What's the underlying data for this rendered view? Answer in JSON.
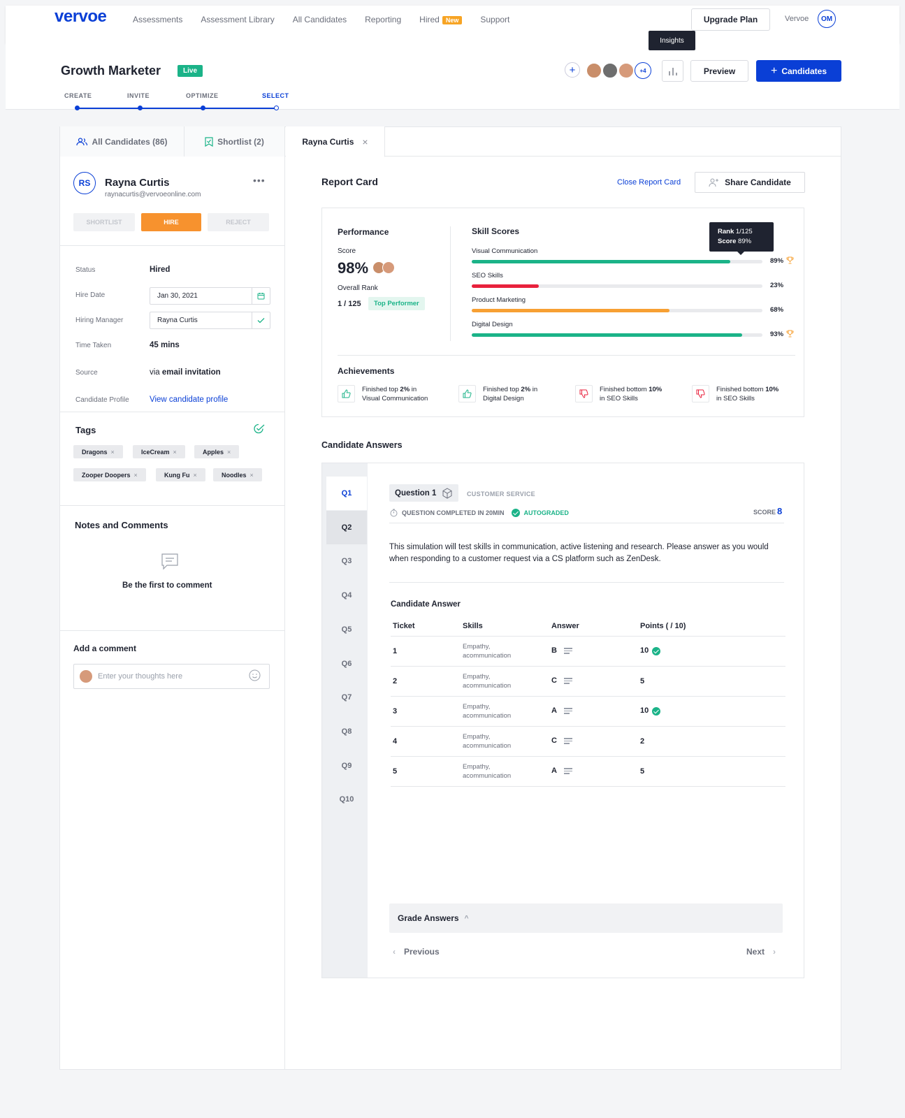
{
  "nav": {
    "logo": "vervoe",
    "links": [
      "Assessments",
      "Assessment Library",
      "All Candidates",
      "Reporting",
      "Hired",
      "Support"
    ],
    "new_badge": "New",
    "upgrade": "Upgrade Plan",
    "account": "Vervoe",
    "avatar": "OM"
  },
  "header": {
    "title": "Growth Marketer",
    "status": "Live",
    "steps": [
      "CREATE",
      "INVITE",
      "OPTIMIZE",
      "SELECT"
    ],
    "more_avatars": "+4",
    "insights_tooltip": "Insights",
    "preview": "Preview",
    "candidates": "Candidates"
  },
  "tabs": {
    "all": "All Candidates (86)",
    "shortlist": "Shortlist (2)",
    "current": "Rayna Curtis"
  },
  "candidate": {
    "initials": "RS",
    "name": "Rayna Curtis",
    "email": "raynacurtis@vervoeonline.com",
    "shortlist": "SHORTLIST",
    "hire": "HIRE",
    "reject": "REJECT",
    "status_label": "Status",
    "status": "Hired",
    "hire_date_label": "Hire Date",
    "hire_date": "Jan 30, 2021",
    "manager_label": "Hiring Manager",
    "manager": "Rayna Curtis",
    "time_label": "Time Taken",
    "time": "45 mins",
    "source_label": "Source",
    "source_prefix": "via",
    "source": "email invitation",
    "profile_label": "Candidate Profile",
    "profile_link": "View candidate profile"
  },
  "tags": {
    "title": "Tags",
    "items": [
      "Dragons",
      "IceCream",
      "Apples",
      "Zooper Doopers",
      "Kung Fu",
      "Noodles"
    ]
  },
  "notes": {
    "title": "Notes and Comments",
    "empty": "Be the first to comment",
    "add_title": "Add a comment",
    "placeholder": "Enter your thoughts here"
  },
  "report": {
    "title": "Report Card",
    "close": "Close Report Card",
    "share": "Share Candidate",
    "performance": {
      "title": "Performance",
      "score_label": "Score",
      "score": "98%",
      "rank_label": "Overall Rank",
      "rank": "1 / 125",
      "badge": "Top Performer"
    },
    "skills_title": "Skill Scores",
    "skills": [
      {
        "name": "Visual Communication",
        "pct": "89%",
        "value": 89,
        "color": "#1bb388"
      },
      {
        "name": "SEO Skills",
        "pct": "23%",
        "value": 23,
        "color": "#e8213c"
      },
      {
        "name": "Product Marketing",
        "pct": "68%",
        "value": 68,
        "color": "#f7a033"
      },
      {
        "name": "Digital Design",
        "pct": "93%",
        "value": 93,
        "color": "#1bb388"
      }
    ],
    "tooltip": {
      "rank_label": "Rank",
      "rank": "1/125",
      "score_label": "Score",
      "score": "89%"
    },
    "achievements_title": "Achievements",
    "achievements": [
      {
        "a": "Finished top ",
        "b": "2%",
        "c": " in",
        "d": "Visual Communication",
        "type": "up"
      },
      {
        "a": "Finished top ",
        "b": "2%",
        "c": " in",
        "d": "Digital Design",
        "type": "up"
      },
      {
        "a": "Finished bottom ",
        "b": "10%",
        "c": "",
        "d": "in SEO Skills",
        "type": "down"
      },
      {
        "a": "Finished bottom ",
        "b": "10%",
        "c": "",
        "d": "in SEO Skills",
        "type": "down"
      }
    ]
  },
  "answers": {
    "title": "Candidate Answers",
    "questions": [
      "Q1",
      "Q2",
      "Q3",
      "Q4",
      "Q5",
      "Q6",
      "Q7",
      "Q8",
      "Q9",
      "Q10"
    ],
    "question_label": "Question 1",
    "category": "CUSTOMER SERVICE",
    "completed": "QUESTION COMPLETED IN 20MIN",
    "autograded": "AUTOGRADED",
    "score_label": "SCORE",
    "score": "8",
    "prompt": "This simulation will test skills in communication, active listening and research. Please answer as you would when responding to a customer request via a CS platform such as ZenDesk.",
    "answer_title": "Candidate Answer",
    "columns": [
      "Ticket",
      "Skills",
      "Answer",
      "Points ( / 10)"
    ],
    "rows": [
      {
        "ticket": "1",
        "skills1": "Empathy,",
        "skills2": "acommunication",
        "answer": "B",
        "points": "10",
        "ok": true
      },
      {
        "ticket": "2",
        "skills1": "Empathy,",
        "skills2": "acommunication",
        "answer": "C",
        "points": "5",
        "ok": false
      },
      {
        "ticket": "3",
        "skills1": "Empathy,",
        "skills2": "acommunication",
        "answer": "A",
        "points": "10",
        "ok": true
      },
      {
        "ticket": "4",
        "skills1": "Empathy,",
        "skills2": "acommunication",
        "answer": "C",
        "points": "2",
        "ok": false
      },
      {
        "ticket": "5",
        "skills1": "Empathy,",
        "skills2": "acommunication",
        "answer": "A",
        "points": "5",
        "ok": false
      }
    ],
    "grade": "Grade Answers",
    "previous": "Previous",
    "next": "Next"
  }
}
